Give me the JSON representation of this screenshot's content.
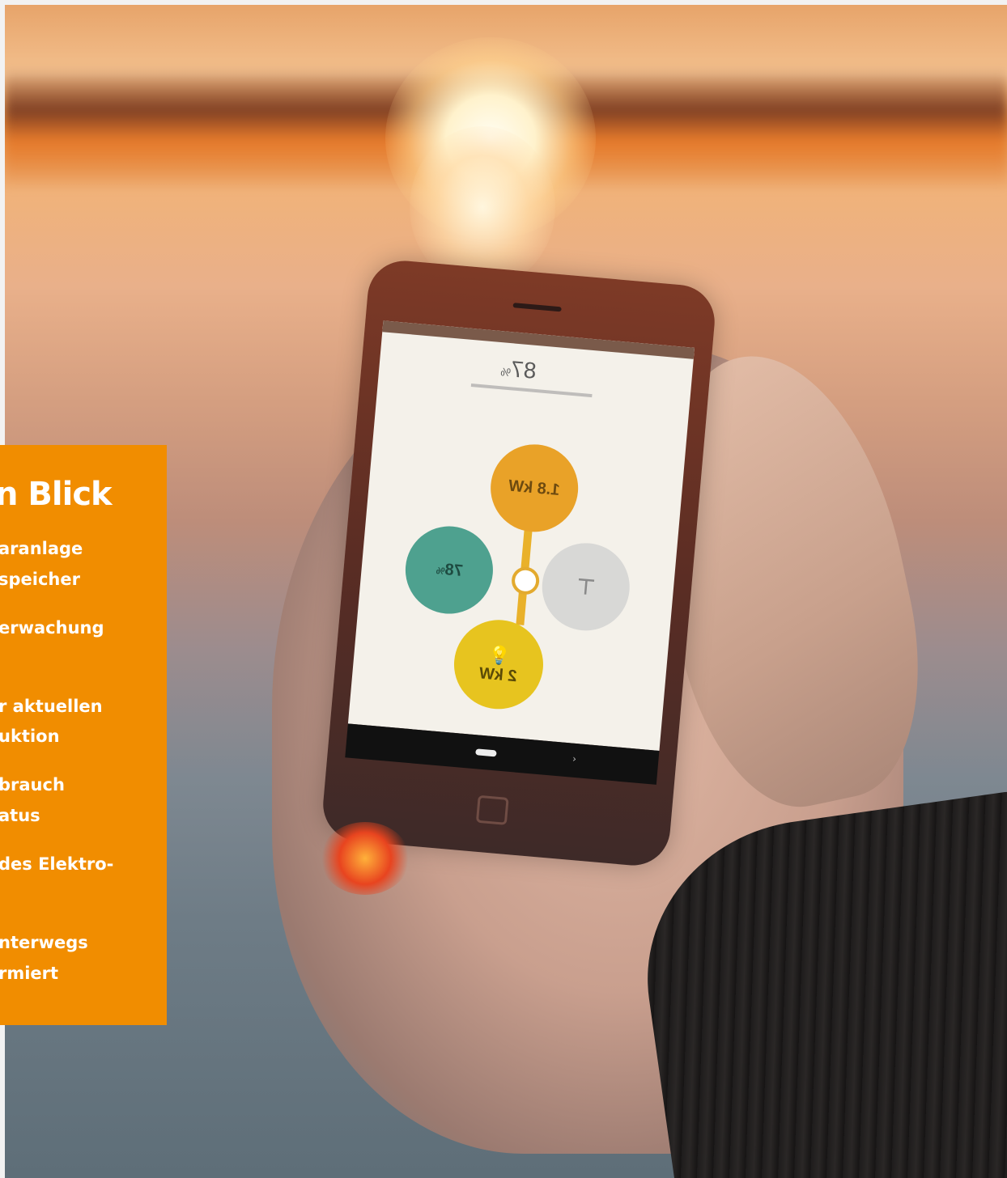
{
  "info_panel": {
    "heading": "n Blick",
    "lines": [
      "aranlage",
      "speicher",
      "erwachung",
      "r aktuellen",
      "uktion",
      "brauch",
      "atus",
      " des Elektro-",
      "nterwegs",
      "rmiert"
    ]
  },
  "phone_app": {
    "battery_percent": "87",
    "battery_unit": "%",
    "nodes": {
      "solar": {
        "value": "1.8 kW",
        "color": "#e9a228"
      },
      "battery": {
        "value": "78",
        "unit": "%",
        "color": "#4ea18f"
      },
      "grid": {
        "color": "#d8d8d6"
      },
      "house": {
        "value": "2 kW",
        "color": "#e7c41f"
      }
    }
  },
  "colors": {
    "panel_orange": "#f18d00",
    "panel_text": "#ffffff"
  }
}
